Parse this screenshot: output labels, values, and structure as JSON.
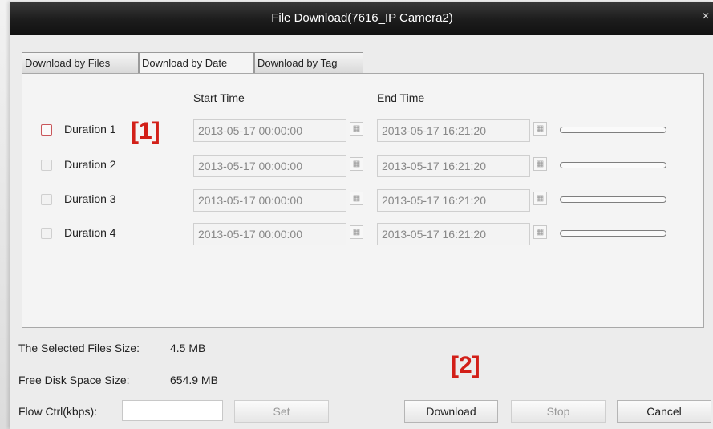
{
  "window": {
    "title": "File Download(7616_IP Camera2)",
    "close_glyph": "×"
  },
  "tabs": [
    {
      "label": "Download by Files",
      "active": false
    },
    {
      "label": "Download by Date",
      "active": true
    },
    {
      "label": "Download by Tag",
      "active": false
    }
  ],
  "columns": {
    "start": "Start Time",
    "end": "End Time"
  },
  "rows": [
    {
      "label": "Duration 1",
      "checked": false,
      "start": "2013-05-17 00:00:00",
      "end": "2013-05-17 16:21:20",
      "progress": 0
    },
    {
      "label": "Duration 2",
      "checked": false,
      "start": "2013-05-17 00:00:00",
      "end": "2013-05-17 16:21:20",
      "progress": 0
    },
    {
      "label": "Duration 3",
      "checked": false,
      "start": "2013-05-17 00:00:00",
      "end": "2013-05-17 16:21:20",
      "progress": 0
    },
    {
      "label": "Duration 4",
      "checked": false,
      "start": "2013-05-17 00:00:00",
      "end": "2013-05-17 16:21:20",
      "progress": 0
    }
  ],
  "annotations": {
    "one": "[1]",
    "two": "[2]"
  },
  "info": {
    "selected_label": "The Selected Files Size:",
    "selected_value": "4.5 MB",
    "free_label": "Free Disk Space Size:",
    "free_value": "654.9 MB",
    "flow_label": "Flow Ctrl(kbps):",
    "flow_value": ""
  },
  "buttons": {
    "set": "Set",
    "download": "Download",
    "stop": "Stop",
    "cancel": "Cancel"
  },
  "icons": {
    "calendar": "calendar-icon",
    "close": "close-icon"
  },
  "colors": {
    "checkbox_highlight": "#c9565a",
    "annotation": "#d21f18",
    "titlebar": "#1c1c1c"
  }
}
